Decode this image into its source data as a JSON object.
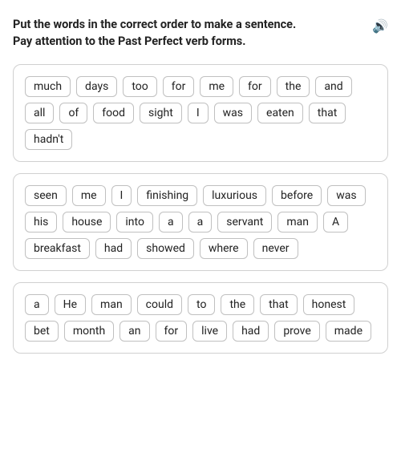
{
  "instructions": {
    "line1": "Put the words in the correct order to make a sentence.",
    "line2": "Pay attention to the Past Perfect verb forms.",
    "speaker_label": "🔊"
  },
  "sentence_groups": [
    {
      "id": "group1",
      "words": [
        "much",
        "days",
        "too",
        "for",
        "me",
        "for",
        "the",
        "and",
        "all",
        "of",
        "food",
        "sight",
        "I",
        "was",
        "eaten",
        "that",
        "hadn't"
      ]
    },
    {
      "id": "group2",
      "words": [
        "seen",
        "me",
        "I",
        "finishing",
        "luxurious",
        "before",
        "was",
        "his",
        "house",
        "into",
        "a",
        "a",
        "servant",
        "man",
        "A",
        "breakfast",
        "had",
        "showed",
        "where",
        "never"
      ]
    },
    {
      "id": "group3",
      "words": [
        "a",
        "He",
        "man",
        "could",
        "to",
        "the",
        "that",
        "honest",
        "bet",
        "month",
        "an",
        "for",
        "live",
        "had",
        "prove",
        "made"
      ]
    }
  ]
}
